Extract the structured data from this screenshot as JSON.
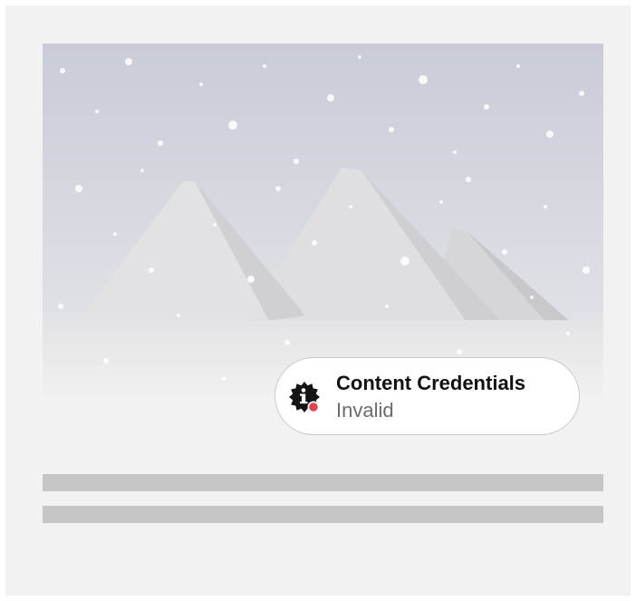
{
  "image": {
    "subject": "snow-covered pyramids in a snowstorm"
  },
  "content_credentials": {
    "title": "Content Credentials",
    "status": "Invalid",
    "icon": "info-badge-icon",
    "status_dot_color": "#e0434b"
  },
  "text_placeholders": {
    "count": 2,
    "color": "#c6c6c6"
  }
}
